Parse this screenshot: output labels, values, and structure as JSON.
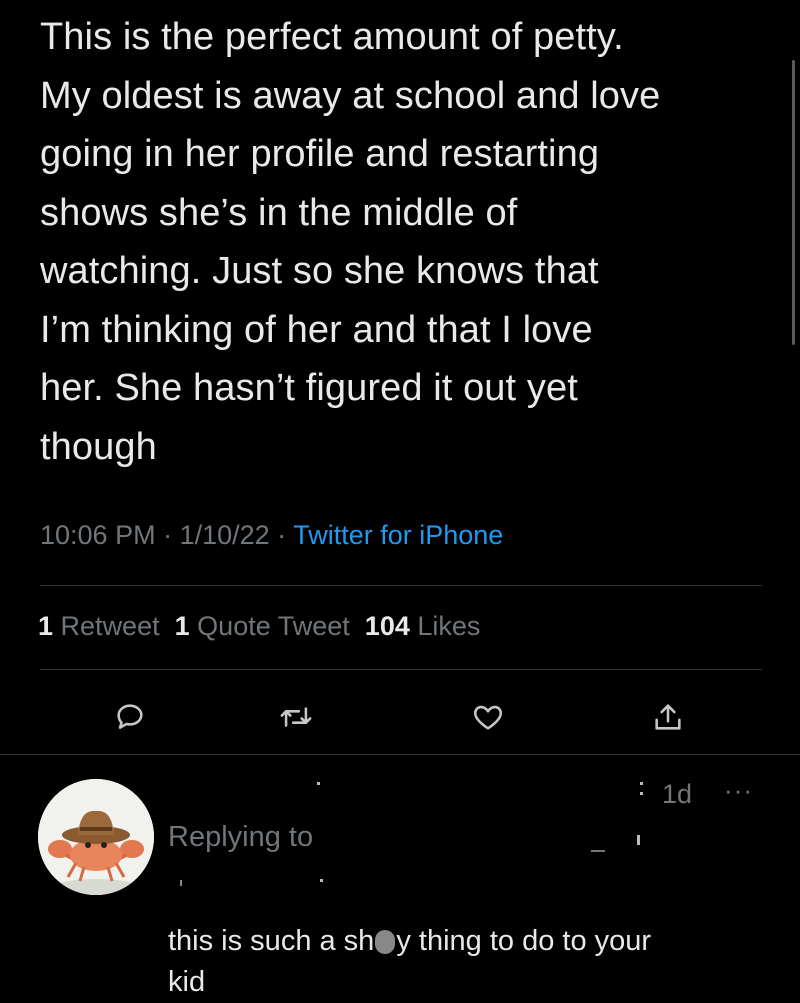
{
  "tweet": {
    "lines": [
      "This is the perfect amount of petty.",
      "My oldest is away at school and love",
      "going in her profile and restarting",
      "shows she’s in the middle of",
      "watching. Just so she knows that",
      "I’m thinking of her and that I love",
      "her. She hasn’t figured it out yet",
      "though"
    ],
    "time": "10:06 PM",
    "separator": " · ",
    "date": "1/10/22",
    "source": "Twitter for iPhone"
  },
  "stats": {
    "retweet_count": "1",
    "retweet_label": "Retweet",
    "quote_count": "1",
    "quote_label": "Quote Tweet",
    "like_count": "104",
    "like_label": "Likes"
  },
  "actions": [
    "reply-icon",
    "retweet-icon",
    "like-icon",
    "share-icon"
  ],
  "reply": {
    "time": "1d",
    "more": "···",
    "replying_to": "Replying to",
    "text_line1_a": "this is such a sh",
    "text_line1_b": "y thing to do to your",
    "text_line2": "kid"
  },
  "colors": {
    "background": "#000000",
    "text": "#e7e9ea",
    "secondary": "#71767b",
    "link": "#1d9bf0",
    "divider": "#2f3336"
  }
}
